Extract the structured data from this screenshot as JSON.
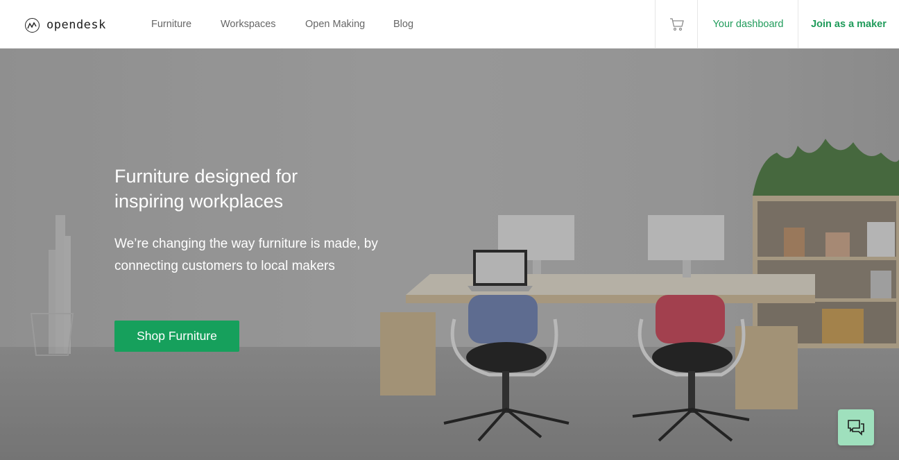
{
  "brand": {
    "name": "opendesk",
    "logo_icon": "opendesk-logo-icon"
  },
  "nav": {
    "items": [
      {
        "label": "Furniture"
      },
      {
        "label": "Workspaces"
      },
      {
        "label": "Open Making"
      },
      {
        "label": "Blog"
      }
    ]
  },
  "header_actions": {
    "cart_icon": "cart-icon",
    "dashboard_label": "Your dashboard",
    "join_label": "Join as a maker"
  },
  "hero": {
    "title": "Furniture designed for inspiring workplaces",
    "subtitle": "We’re changing the way furniture is made, by connecting customers to local makers",
    "cta_label": "Shop Furniture"
  },
  "chat": {
    "icon": "chat-icon"
  },
  "colors": {
    "accent": "#16a05c",
    "link_green": "#1f9b5a",
    "chat_bg": "#9fe0bd"
  }
}
